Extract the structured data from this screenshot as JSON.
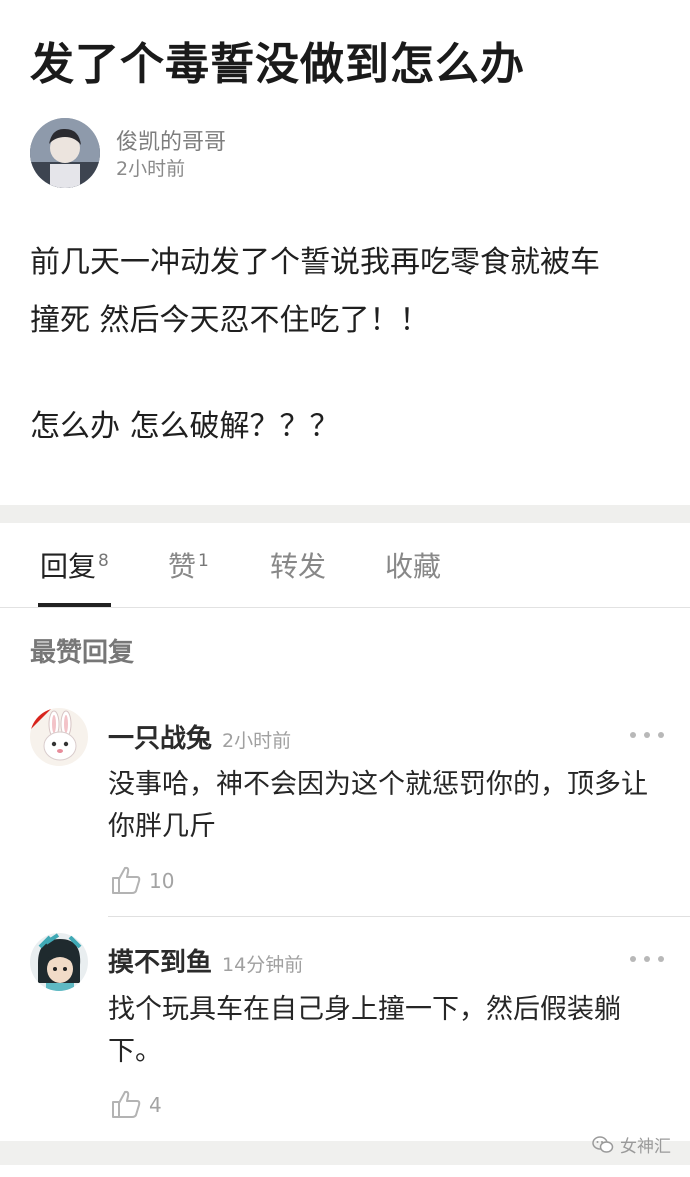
{
  "post": {
    "title": "发了个毒誓没做到怎么办",
    "author": "俊凯的哥哥",
    "time": "2小时前",
    "body_line1": "前几天一冲动发了个誓说我再吃零食就被车",
    "body_line2": "撞死 然后今天忍不住吃了！！",
    "body_line3": "怎么办 怎么破解？？？"
  },
  "tabs": [
    {
      "label": "回复",
      "count": "8"
    },
    {
      "label": "赞",
      "count": "1"
    },
    {
      "label": "转发"
    },
    {
      "label": "收藏"
    }
  ],
  "section_heading": "最赞回复",
  "replies": [
    {
      "user": "一只战兔",
      "time": "2小时前",
      "text": "没事哈，神不会因为这个就惩罚你的，顶多让你胖几斤",
      "likes": "10"
    },
    {
      "user": "摸不到鱼",
      "time": "14分钟前",
      "text": "找个玩具车在自己身上撞一下，然后假装躺下。",
      "likes": "4"
    }
  ],
  "watermark": "女神汇",
  "icons": {
    "more": "more-dots-icon",
    "like": "thumbs-up-icon",
    "watermark": "wechat-icon"
  },
  "colors": {
    "text_primary": "#222222",
    "text_muted": "#888888",
    "band": "#efefed"
  }
}
